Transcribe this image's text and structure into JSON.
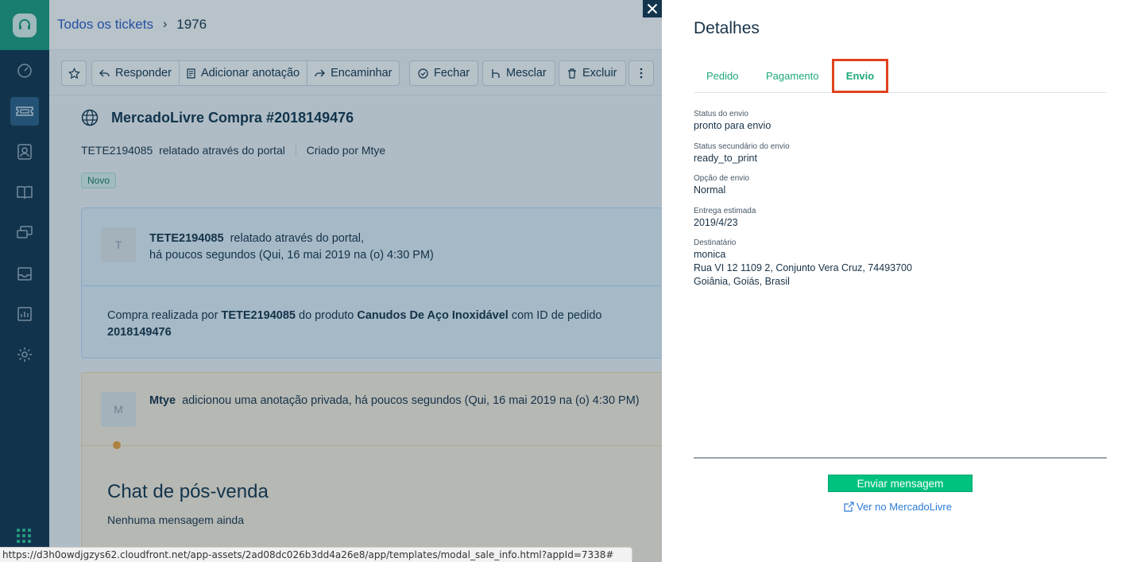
{
  "sidebar": {
    "items": [
      {
        "icon": "dashboard-icon"
      },
      {
        "icon": "tickets-icon",
        "active": true
      },
      {
        "icon": "contacts-icon"
      },
      {
        "icon": "solutions-book-icon"
      },
      {
        "icon": "forums-icon"
      },
      {
        "icon": "team-inbox-icon"
      },
      {
        "icon": "reports-icon"
      },
      {
        "icon": "settings-gear-icon"
      }
    ]
  },
  "header": {
    "breadcrumb_link": "Todos os tickets",
    "ticket_number": "1976"
  },
  "toolbar": {
    "respond": "Responder",
    "add_note": "Adicionar anotação",
    "forward": "Encaminhar",
    "close": "Fechar",
    "merge": "Mesclar",
    "delete": "Excluir"
  },
  "ticket": {
    "subject": "MercadoLivre Compra #2018149476",
    "requester": "TETE2194085",
    "reported_via": "relatado através do portal",
    "created_by": "Criado por Mtye",
    "status_badge": "Novo"
  },
  "message": {
    "avatar_letter": "T",
    "author": "TETE2194085",
    "via": "relatado através do portal,",
    "time": "há poucos segundos (Qui, 16 mai 2019 na (o) 4:30 PM)",
    "body_prefix": "Compra realizada por ",
    "body_buyer": "TETE2194085",
    "body_mid": " do produto ",
    "body_product": "Canudos De Aço Inoxidável",
    "body_suffix": " com ID de pedido ",
    "body_order_id": "2018149476"
  },
  "note": {
    "avatar_letter": "M",
    "author": "Mtye",
    "text": "adicionou uma anotação privada, há poucos segundos (Qui, 16 mai 2019 na (o) 4:30 PM)",
    "chat_title": "Chat de pós-venda",
    "chat_empty": "Nenhuma mensagem ainda"
  },
  "modal": {
    "title": "Detalhes",
    "tabs": [
      "Pedido",
      "Pagamento",
      "Envio"
    ],
    "active_tab": "Envio",
    "fields": {
      "status_label": "Status do envio",
      "status_value": "pronto para envio",
      "substatus_label": "Status secundário do envio",
      "substatus_value": "ready_to_print",
      "option_label": "Opção de envio",
      "option_value": "Normal",
      "eta_label": "Entrega estimada",
      "eta_value": "2019/4/23",
      "recipient_label": "Destinatário",
      "recipient_name": "monica",
      "recipient_address": "Rua VI 12 1109 2, Conjunto Vera Cruz, 74493700",
      "recipient_city": "Goiânia, Goiás, Brasil"
    },
    "send_button": "Enviar mensagem",
    "ml_link": "Ver no MercadoLivre"
  },
  "statusbar": {
    "url": "https://d3h0owdjgzys62.cloudfront.net/app-assets/2ad08dc026b3dd4a26e8/app/templates/modal_sale_info.html?appId=7338#"
  },
  "colors": {
    "sidebar": "#12344d",
    "brand": "#1d9e7e",
    "link_green": "#1ea97c",
    "highlight": "#e0431c",
    "send_button": "#00c27f"
  }
}
